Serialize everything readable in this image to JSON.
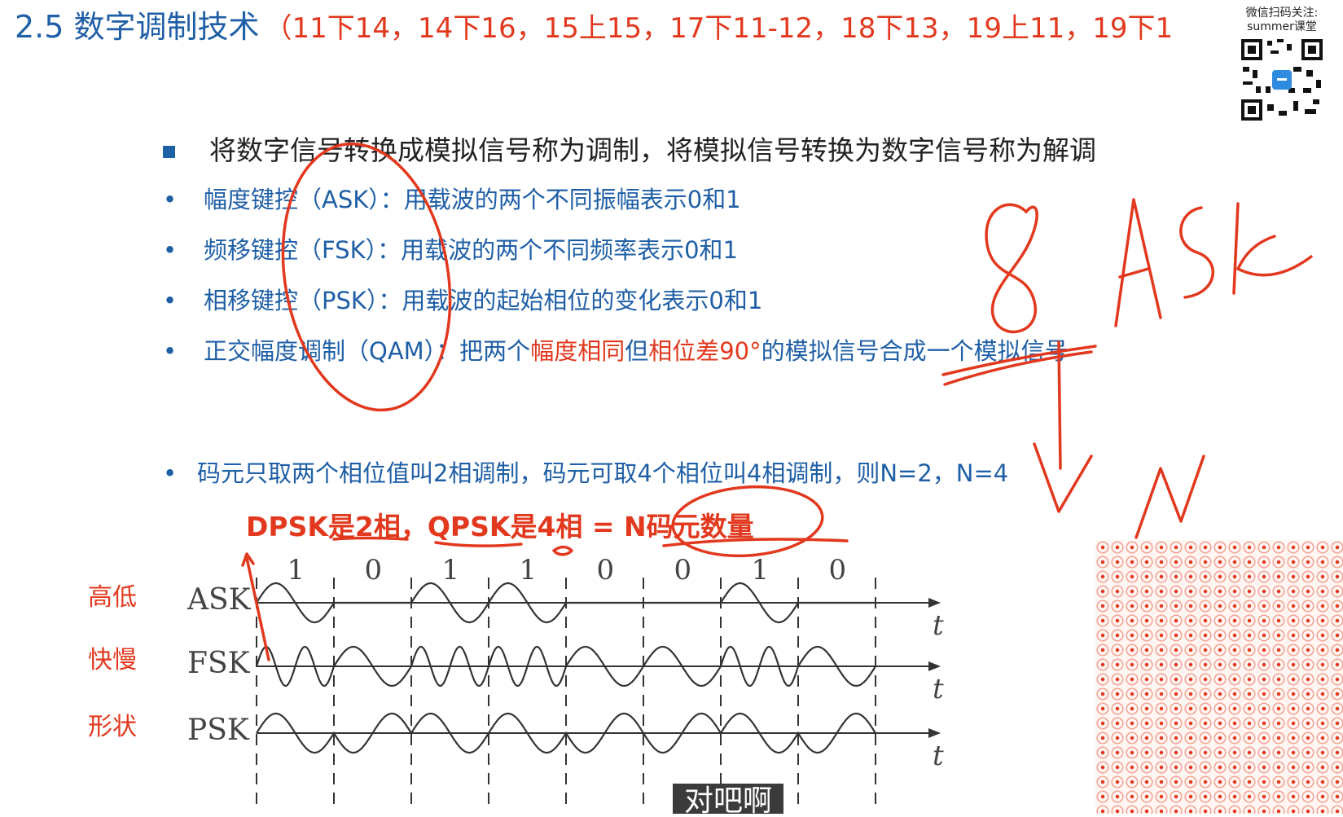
{
  "title": {
    "text": "2.5 数字调制技术",
    "exam_refs": "（11下14，14下16，15上15，17下11-12，18下13，19上11，19下1"
  },
  "qr": {
    "caption_line1": "微信扫码关注:",
    "caption_line2": "summer课堂"
  },
  "main_point": "将数字信号转换成模拟信号称为调制，将模拟信号转换为数字信号称为解调",
  "bullets": [
    {
      "dot": "•",
      "text": "幅度键控（ASK）：用载波的两个不同振幅表示0和1"
    },
    {
      "dot": "•",
      "text": "频移键控（FSK）：用载波的两个不同频率表示0和1"
    },
    {
      "dot": "•",
      "text": "相移键控（PSK）：用载波的起始相位的变化表示0和1"
    }
  ],
  "qam": {
    "dot": "•",
    "prefix": "正交幅度调制（QAM）：把两个",
    "red1": "幅度相同",
    "mid": "但",
    "red2": "相位差90°",
    "suffix": "的模拟信号合成一个模拟信号"
  },
  "note": {
    "dot": "•",
    "text": "码元只取两个相位值叫2相调制，码元可取4个相位叫4相调制，则N=2，N=4"
  },
  "formula": "DPSK是2相，QPSK是4相   = N码元数量",
  "side_labels": [
    "高低",
    "快慢",
    "形状"
  ],
  "diagram": {
    "bits": [
      "1",
      "0",
      "1",
      "1",
      "0",
      "0",
      "1",
      "0"
    ],
    "signals": [
      "ASK",
      "FSK",
      "PSK"
    ],
    "axis_label": "t"
  },
  "caption": "对吧啊",
  "colors": {
    "blue": "#1f5fa6",
    "red": "#e2381e",
    "wave": "#333333"
  }
}
